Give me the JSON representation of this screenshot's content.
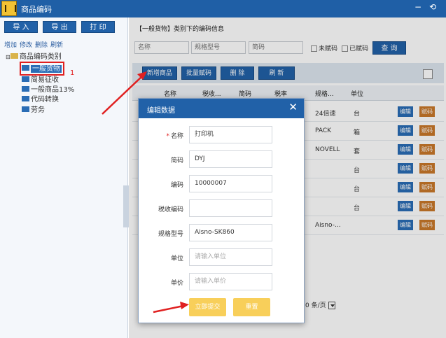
{
  "window": {
    "title": "商品编码",
    "minimize": "−",
    "restore": "⟲"
  },
  "left": {
    "buttons": [
      "导 入",
      "导 出",
      "打 印"
    ],
    "links": [
      "增加",
      "修改",
      "删除",
      "刷新"
    ],
    "tree_root": "商品编码类别",
    "tree_items": [
      "一般货物",
      "简易征收",
      "一般商品13%",
      "代码转换",
      "劳务"
    ],
    "annotation": "1"
  },
  "right": {
    "crumb": "【一般货物】类别下的编码信息",
    "filter": {
      "name_ph": "名称",
      "spec_ph": "规格型号",
      "short_ph": "简码",
      "chk_unassigned": "未赋码",
      "chk_assigned": "已赋码",
      "query": "查 询"
    },
    "toolbar": [
      "新增商品",
      "批量赋码",
      "删 除",
      "刷 新"
    ],
    "headers": [
      "名称",
      "税收...",
      "简码",
      "税率",
      "规格...",
      "单位"
    ],
    "rows": [
      {
        "spec": "24倍速",
        "unit": "台"
      },
      {
        "spec": "PACK",
        "unit": "箱"
      },
      {
        "spec": "NOVELL",
        "unit": "套"
      },
      {
        "spec": "",
        "unit": "台"
      },
      {
        "spec": "",
        "unit": "台"
      },
      {
        "spec": "",
        "unit": "台"
      },
      {
        "spec": "Aisno-...",
        "unit": ""
      }
    ],
    "row_edit": "编辑",
    "row_code": "赋码",
    "pager": "0 条/页"
  },
  "modal": {
    "title": "编辑数据",
    "close": "✕",
    "fields": [
      {
        "label": "名称",
        "value": "打印机",
        "required": true
      },
      {
        "label": "简码",
        "value": "DYJ"
      },
      {
        "label": "编码",
        "value": "10000007"
      },
      {
        "label": "税收编码",
        "value": ""
      },
      {
        "label": "规格型号",
        "value": "Aisno-SK860"
      },
      {
        "label": "单位",
        "value": "请输入单位",
        "placeholder": true
      },
      {
        "label": "单价",
        "value": "请输入单价",
        "placeholder": true
      }
    ],
    "submit": "立即提交",
    "reset": "重置"
  },
  "colors": {
    "primary": "#2161a8",
    "accent_yellow": "#f8cf5a",
    "code_orange": "#c9782a",
    "annotation_red": "#e02020"
  }
}
